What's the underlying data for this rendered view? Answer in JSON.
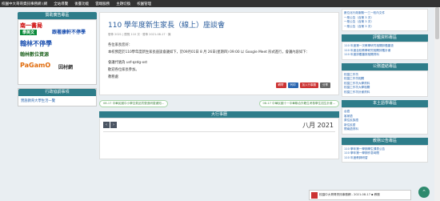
{
  "topbar": {
    "items": [
      "校園中大哥哥資訊事務網 (網",
      "全站導覽",
      "後臺功能",
      "雲端服務",
      "主題切換",
      "校園管理"
    ]
  },
  "left": {
    "ad_head": "贊助廣告專區",
    "ad_lines": [
      "南一書局",
      "南一書局",
      "學英文",
      "跟著康軒不停學",
      "翰林不停學",
      "翰林數位資源",
      "PaGamO",
      "因材網"
    ],
    "admin_head": "行政協調事項",
    "admin_link": "實施教育大學生活一覽"
  },
  "article": {
    "title": "110 學年度新生家長（線上）座談會",
    "meta": "發佈 2021 | 閱覽 110 次 ‧ 發佈 2021-08-17 ‧ 篇",
    "p1": "各位家長您好：",
    "p2": "本校預定於110學年度新生家長座談會議如下，於09月01日 8 月 26日(星期四) 09:00 以 Google Meet 形式進行，會議內容如下：",
    "p3": "會議代號為 usf-qzdg-xst",
    "p4": "歡迎各位家長參加。",
    "p5": "教務處",
    "btn1": "轉寄",
    "btn2": "列印",
    "btn3": "加入行事曆",
    "btn4": "分享",
    "prev": "08-17 中華民國中小學空氣品質營造研習通知...",
    "next": "08-17 中華民國十一中華聯合外籍生考核學生招生計畫..."
  },
  "calendar": {
    "head": "大行事曆",
    "month": "八月 2021"
  },
  "right": {
    "top_lines": [
      "數位化行政服務──三一校內文件",
      "一般公告（含第 3 次）",
      "一般公告（含第 3 次）",
      "一般公告（含第 3 次）",
      "一般公告（含第 3 次）"
    ],
    "sec1": "評鑑資料專區",
    "sec1_lines": [
      "110 年度第一次教學研究相關評鑑審查",
      "110 年度全校教學研究相關評鑑計畫",
      "110 年度評鑑審核相關資料"
    ],
    "sec2": "公務連結專區",
    "sec2_lines": [
      "校園工作坊",
      "校園工作坊相關",
      "校園工作坊大學資料",
      "校園工作坊大學相關",
      "校園工作坊計畫資料",
      "校園工作坊計畫相關"
    ],
    "sec3": "本土語學專區",
    "sec3_lines": [
      "台語",
      "客家語",
      "原住民族語",
      "新住民語",
      "閩南語資料",
      "客語語料"
    ],
    "sec4": "教務公告專區",
    "sec4_lines": [
      "110 學年第一學期學生課表公告",
      "110 學年第一學期作息時間",
      "110 年度教師研習"
    ]
  },
  "toast": {
    "text": "校園中大哥哥資訊事務網 - 2021-08-17 ▪ 教務"
  }
}
